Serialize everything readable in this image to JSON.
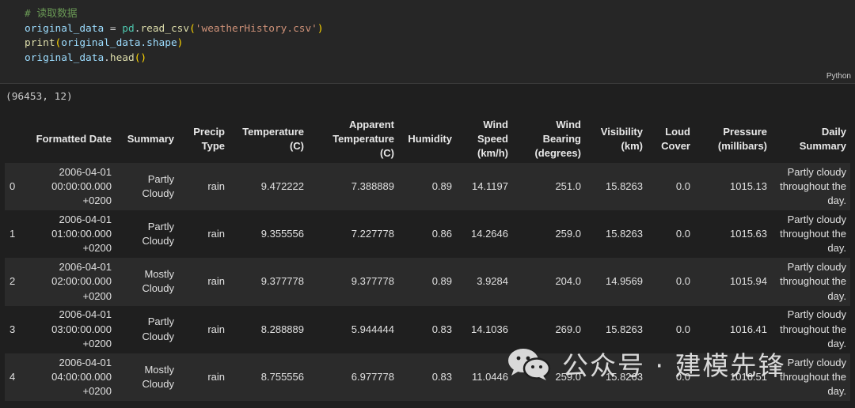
{
  "code": {
    "comment": "# 读取数据",
    "line1": {
      "var": "original_data",
      "op": " = ",
      "mod": "pd",
      "dot": ".",
      "func": "read_csv",
      "open": "(",
      "str": "'weatherHistory.csv'",
      "close": ")"
    },
    "line2": {
      "func": "print",
      "open": "(",
      "var": "original_data",
      "attr": ".shape",
      "close": ")"
    },
    "line3": {
      "var": "original_data",
      "dot": ".",
      "func": "head",
      "parens": "()"
    },
    "language": "Python"
  },
  "output": {
    "shape": "(96453, 12)"
  },
  "table": {
    "columns": [
      {
        "lines": [
          ""
        ]
      },
      {
        "lines": [
          "Formatted Date"
        ]
      },
      {
        "lines": [
          "Summary"
        ]
      },
      {
        "lines": [
          "Precip",
          "Type"
        ]
      },
      {
        "lines": [
          "Temperature",
          "(C)"
        ]
      },
      {
        "lines": [
          "Apparent",
          "Temperature",
          "(C)"
        ]
      },
      {
        "lines": [
          "Humidity"
        ]
      },
      {
        "lines": [
          "Wind",
          "Speed",
          "(km/h)"
        ]
      },
      {
        "lines": [
          "Wind",
          "Bearing",
          "(degrees)"
        ]
      },
      {
        "lines": [
          "Visibility",
          "(km)"
        ]
      },
      {
        "lines": [
          "Loud",
          "Cover"
        ]
      },
      {
        "lines": [
          "Pressure",
          "(millibars)"
        ]
      },
      {
        "lines": [
          "Daily Summary"
        ]
      }
    ],
    "rows": [
      {
        "index": "0",
        "date": [
          "2006-04-01",
          "00:00:00.000",
          "+0200"
        ],
        "summary": [
          "Partly",
          "Cloudy"
        ],
        "precip": "rain",
        "temp": "9.472222",
        "apparent": "7.388889",
        "humidity": "0.89",
        "wind_speed": "14.1197",
        "wind_bearing": "251.0",
        "visibility": "15.8263",
        "loud_cover": "0.0",
        "pressure": "1015.13",
        "daily": [
          "Partly cloudy",
          "throughout the",
          "day."
        ]
      },
      {
        "index": "1",
        "date": [
          "2006-04-01",
          "01:00:00.000",
          "+0200"
        ],
        "summary": [
          "Partly",
          "Cloudy"
        ],
        "precip": "rain",
        "temp": "9.355556",
        "apparent": "7.227778",
        "humidity": "0.86",
        "wind_speed": "14.2646",
        "wind_bearing": "259.0",
        "visibility": "15.8263",
        "loud_cover": "0.0",
        "pressure": "1015.63",
        "daily": [
          "Partly cloudy",
          "throughout the",
          "day."
        ]
      },
      {
        "index": "2",
        "date": [
          "2006-04-01",
          "02:00:00.000",
          "+0200"
        ],
        "summary": [
          "Mostly",
          "Cloudy"
        ],
        "precip": "rain",
        "temp": "9.377778",
        "apparent": "9.377778",
        "humidity": "0.89",
        "wind_speed": "3.9284",
        "wind_bearing": "204.0",
        "visibility": "14.9569",
        "loud_cover": "0.0",
        "pressure": "1015.94",
        "daily": [
          "Partly cloudy",
          "throughout the",
          "day."
        ]
      },
      {
        "index": "3",
        "date": [
          "2006-04-01",
          "03:00:00.000",
          "+0200"
        ],
        "summary": [
          "Partly",
          "Cloudy"
        ],
        "precip": "rain",
        "temp": "8.288889",
        "apparent": "5.944444",
        "humidity": "0.83",
        "wind_speed": "14.1036",
        "wind_bearing": "269.0",
        "visibility": "15.8263",
        "loud_cover": "0.0",
        "pressure": "1016.41",
        "daily": [
          "Partly cloudy",
          "throughout the",
          "day."
        ]
      },
      {
        "index": "4",
        "date": [
          "2006-04-01",
          "04:00:00.000",
          "+0200"
        ],
        "summary": [
          "Mostly",
          "Cloudy"
        ],
        "precip": "rain",
        "temp": "8.755556",
        "apparent": "6.977778",
        "humidity": "0.83",
        "wind_speed": "11.0446",
        "wind_bearing": "259.0",
        "visibility": "15.8263",
        "loud_cover": "0.0",
        "pressure": "1016.51",
        "daily": [
          "Partly cloudy",
          "throughout the",
          "day."
        ]
      }
    ]
  },
  "watermark": {
    "text": "公众号 · 建模先锋",
    "icon": "wechat-icon"
  }
}
